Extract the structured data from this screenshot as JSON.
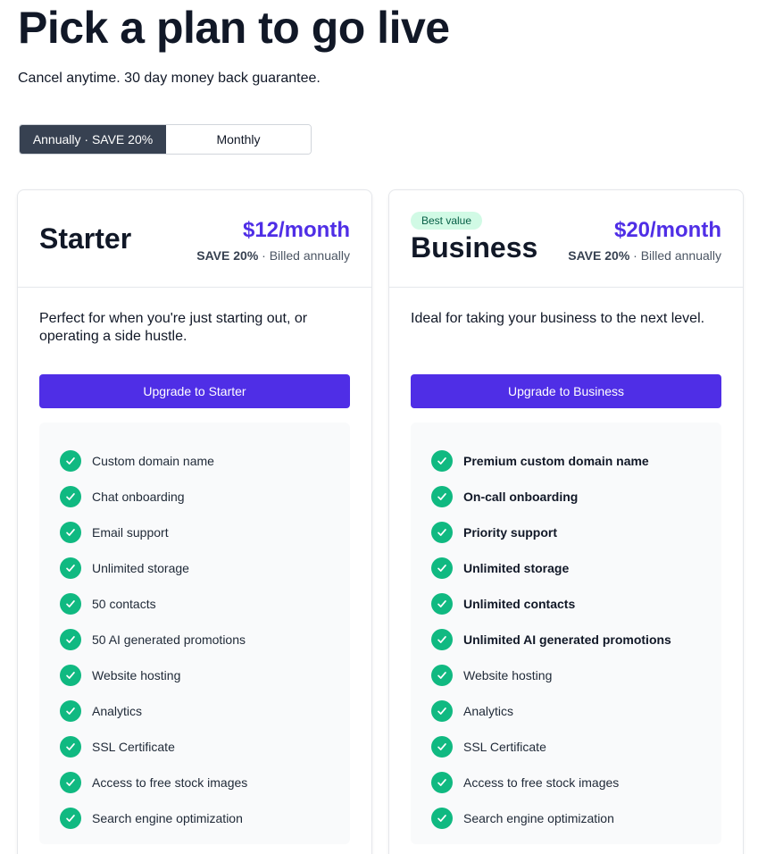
{
  "header": {
    "title": "Pick a plan to go live",
    "subtitle": "Cancel anytime. 30 day money back guarantee."
  },
  "billing_toggle": {
    "annual_label": "Annually · SAVE 20%",
    "monthly_label": "Monthly",
    "selected": "annual"
  },
  "colors": {
    "accent": "#4f2ee6",
    "check_green": "#10b981",
    "badge_bg": "#d1fae5",
    "toggle_active": "#374151"
  },
  "plans": [
    {
      "name": "Starter",
      "badge": "",
      "price": "$12/month",
      "save": "SAVE 20%",
      "billing": " · Billed annually",
      "description": "Perfect for when you're just starting out, or operating a side hustle.",
      "button": "Upgrade to Starter",
      "features": [
        {
          "label": "Custom domain name",
          "bold": false,
          "icon": "check-circle-icon"
        },
        {
          "label": "Chat onboarding",
          "bold": false,
          "icon": "check-circle-icon"
        },
        {
          "label": "Email support",
          "bold": false,
          "icon": "check-circle-icon"
        },
        {
          "label": "Unlimited storage",
          "bold": false,
          "icon": "check-circle-icon"
        },
        {
          "label": "50 contacts",
          "bold": false,
          "icon": "check-circle-icon"
        },
        {
          "label": "50 AI generated promotions",
          "bold": false,
          "icon": "check-circle-icon"
        },
        {
          "label": "Website hosting",
          "bold": false,
          "icon": "check-circle-icon"
        },
        {
          "label": "Analytics",
          "bold": false,
          "icon": "check-circle-icon"
        },
        {
          "label": "SSL Certificate",
          "bold": false,
          "icon": "check-circle-icon"
        },
        {
          "label": "Access to free stock images",
          "bold": false,
          "icon": "check-circle-icon"
        },
        {
          "label": "Search engine optimization",
          "bold": false,
          "icon": "check-circle-icon"
        }
      ]
    },
    {
      "name": "Business",
      "badge": "Best value",
      "price": "$20/month",
      "save": "SAVE 20%",
      "billing": " · Billed annually",
      "description": "Ideal for taking your business to the next level.",
      "button": "Upgrade to Business",
      "features": [
        {
          "label": "Premium custom domain name",
          "bold": true,
          "icon": "check-circle-icon"
        },
        {
          "label": "On-call onboarding",
          "bold": true,
          "icon": "check-circle-icon"
        },
        {
          "label": "Priority support",
          "bold": true,
          "icon": "check-circle-icon"
        },
        {
          "label": "Unlimited storage",
          "bold": true,
          "icon": "check-circle-icon"
        },
        {
          "label": "Unlimited contacts",
          "bold": true,
          "icon": "check-circle-icon"
        },
        {
          "label": "Unlimited AI generated promotions",
          "bold": true,
          "icon": "check-circle-icon"
        },
        {
          "label": "Website hosting",
          "bold": false,
          "icon": "check-circle-icon"
        },
        {
          "label": "Analytics",
          "bold": false,
          "icon": "check-circle-icon"
        },
        {
          "label": "SSL Certificate",
          "bold": false,
          "icon": "check-circle-icon"
        },
        {
          "label": "Access to free stock images",
          "bold": false,
          "icon": "check-circle-icon"
        },
        {
          "label": "Search engine optimization",
          "bold": false,
          "icon": "check-circle-icon"
        }
      ]
    }
  ]
}
